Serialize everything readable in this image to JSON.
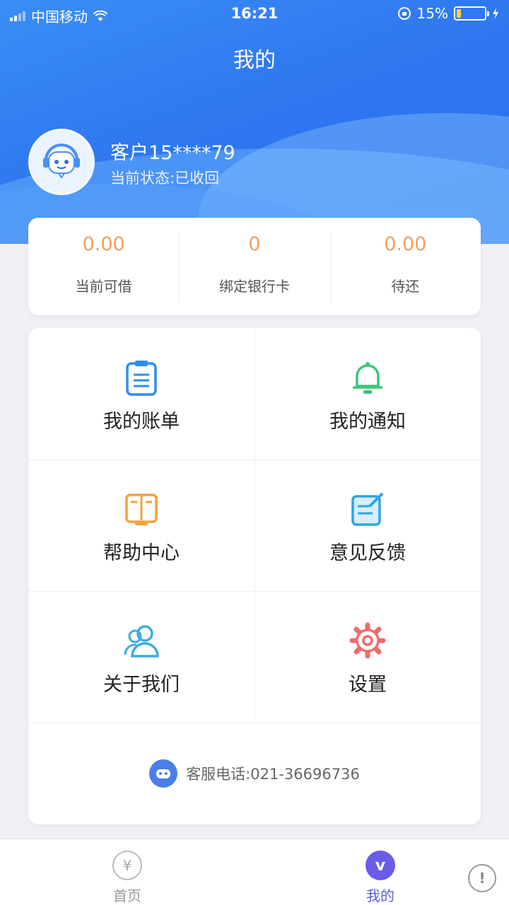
{
  "status_bar": {
    "carrier": "中国移动",
    "time": "16:21",
    "battery_percent": "15%",
    "battery_level": 0.15
  },
  "page": {
    "title": "我的"
  },
  "user": {
    "name": "客户15****79",
    "status": "当前状态:已收回"
  },
  "stats": [
    {
      "value": "0.00",
      "label": "当前可借"
    },
    {
      "value": "0",
      "label": "绑定银行卡"
    },
    {
      "value": "0.00",
      "label": "待还"
    }
  ],
  "menu": [
    {
      "label": "我的账单",
      "icon": "bill-icon",
      "color": "#2f8cf0"
    },
    {
      "label": "我的通知",
      "icon": "bell-icon",
      "color": "#3cc47c"
    },
    {
      "label": "帮助中心",
      "icon": "book-icon",
      "color": "#f5a23c"
    },
    {
      "label": "意见反馈",
      "icon": "feedback-icon",
      "color": "#2fa3e8"
    },
    {
      "label": "关于我们",
      "icon": "users-icon",
      "color": "#3aaee0"
    },
    {
      "label": "设置",
      "icon": "gear-icon",
      "color": "#f06b6b"
    }
  ],
  "service": {
    "phone_text": "客服电话:021-36696736",
    "icon": "service-icon"
  },
  "tabbar": [
    {
      "label": "首页",
      "icon": "yen-icon",
      "active": false
    },
    {
      "label": "我的",
      "icon": "mine-icon",
      "active": true
    }
  ],
  "colors": {
    "header_blue": "#2f78f0",
    "stat_value": "#f0a060",
    "tab_active": "#5b5fd8"
  }
}
